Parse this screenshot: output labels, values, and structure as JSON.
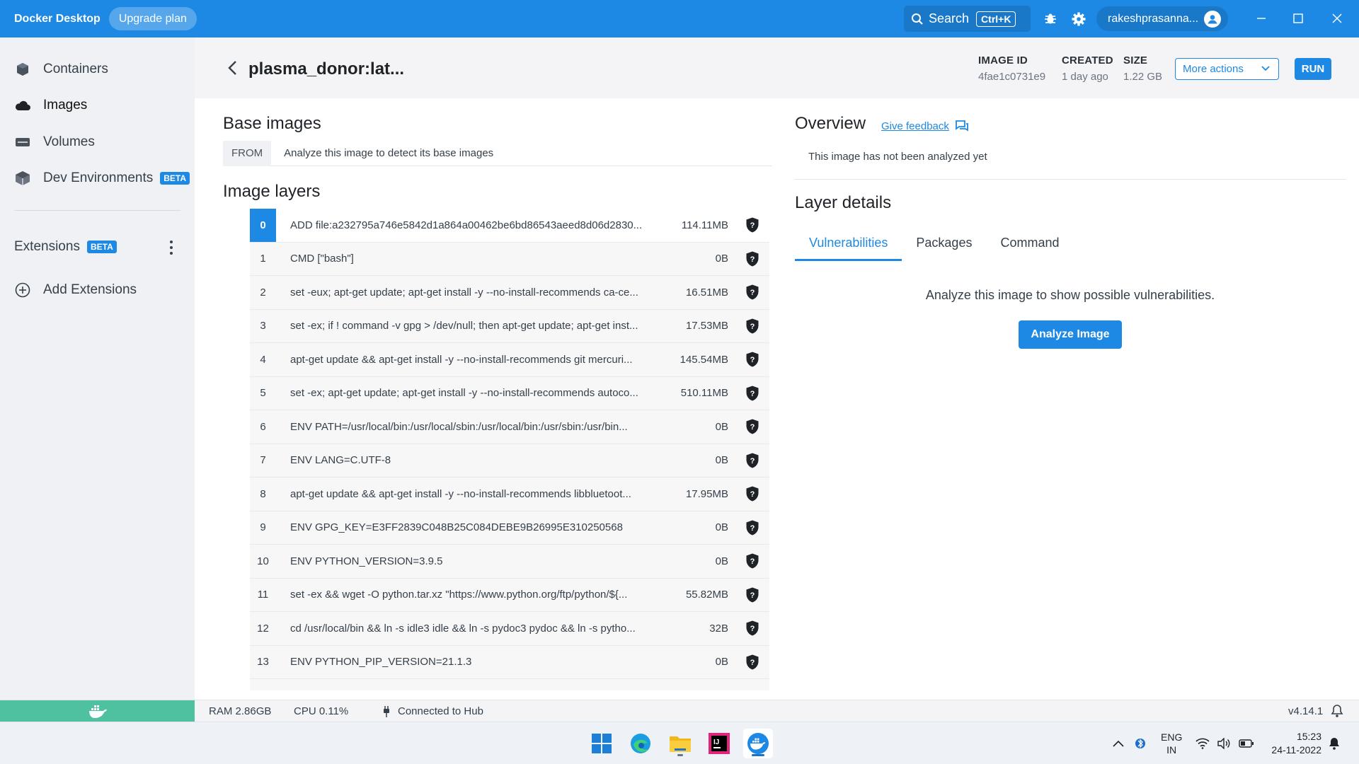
{
  "titlebar": {
    "app_name": "Docker Desktop",
    "upgrade_label": "Upgrade plan",
    "search_label": "Search",
    "search_shortcut": "Ctrl+K",
    "username": "rakeshprasanna..."
  },
  "sidebar": {
    "items": [
      {
        "label": "Containers"
      },
      {
        "label": "Images"
      },
      {
        "label": "Volumes"
      },
      {
        "label": "Dev Environments",
        "badge": "BETA"
      }
    ],
    "extensions_label": "Extensions",
    "extensions_badge": "BETA",
    "add_extensions_label": "Add Extensions"
  },
  "header": {
    "image_name": "plasma_donor:lat...",
    "image_id_label": "IMAGE ID",
    "image_id": "4fae1c0731e9",
    "created_label": "CREATED",
    "created": "1 day ago",
    "size_label": "SIZE",
    "size": "1.22 GB",
    "more_actions_label": "More actions",
    "run_label": "RUN"
  },
  "base_images": {
    "title": "Base images",
    "from_tag": "FROM",
    "message": "Analyze this image to detect its base images"
  },
  "image_layers": {
    "title": "Image layers",
    "selected_index": 0,
    "rows": [
      {
        "idx": "0",
        "cmd": "ADD file:a232795a746e5842d1a864a00462be6bd86543aeed8d06d2830...",
        "size": "114.11MB"
      },
      {
        "idx": "1",
        "cmd": "CMD [\"bash\"]",
        "size": "0B"
      },
      {
        "idx": "2",
        "cmd": "set -eux; apt-get update; apt-get install -y --no-install-recommends ca-ce...",
        "size": "16.51MB"
      },
      {
        "idx": "3",
        "cmd": "set -ex; if ! command -v gpg > /dev/null; then apt-get update; apt-get inst...",
        "size": "17.53MB"
      },
      {
        "idx": "4",
        "cmd": "apt-get update && apt-get install -y --no-install-recommends git mercuri...",
        "size": "145.54MB"
      },
      {
        "idx": "5",
        "cmd": "set -ex; apt-get update; apt-get install -y --no-install-recommends autoco...",
        "size": "510.11MB"
      },
      {
        "idx": "6",
        "cmd": "ENV PATH=/usr/local/bin:/usr/local/sbin:/usr/local/bin:/usr/sbin:/usr/bin...",
        "size": "0B"
      },
      {
        "idx": "7",
        "cmd": "ENV LANG=C.UTF-8",
        "size": "0B"
      },
      {
        "idx": "8",
        "cmd": "apt-get update && apt-get install -y --no-install-recommends libbluetoot...",
        "size": "17.95MB"
      },
      {
        "idx": "9",
        "cmd": "ENV GPG_KEY=E3FF2839C048B25C084DEBE9B26995E310250568",
        "size": "0B"
      },
      {
        "idx": "10",
        "cmd": "ENV PYTHON_VERSION=3.9.5",
        "size": "0B"
      },
      {
        "idx": "11",
        "cmd": "set -ex && wget -O python.tar.xz \"https://www.python.org/ftp/python/${...",
        "size": "55.82MB"
      },
      {
        "idx": "12",
        "cmd": "cd /usr/local/bin && ln -s idle3 idle && ln -s pydoc3 pydoc && ln -s pytho...",
        "size": "32B"
      },
      {
        "idx": "13",
        "cmd": "ENV PYTHON_PIP_VERSION=21.1.3",
        "size": "0B"
      }
    ]
  },
  "overview": {
    "title": "Overview",
    "feedback_label": "Give feedback",
    "message": "This image has not been analyzed yet"
  },
  "layer_details": {
    "title": "Layer details",
    "tabs": [
      {
        "label": "Vulnerabilities"
      },
      {
        "label": "Packages"
      },
      {
        "label": "Command"
      }
    ],
    "active_tab": "Vulnerabilities",
    "message": "Analyze this image to show possible vulnerabilities.",
    "analyze_label": "Analyze Image"
  },
  "statusbar": {
    "ram": "RAM 2.86GB",
    "cpu": "CPU 0.11%",
    "hub": "Connected to Hub",
    "version": "v4.14.1"
  },
  "taskbar": {
    "lang_top": "ENG",
    "lang_bottom": "IN",
    "time": "15:23",
    "date": "24-11-2022"
  },
  "colors": {
    "accent": "#1d89e4",
    "status_green": "#4fc1a0"
  }
}
